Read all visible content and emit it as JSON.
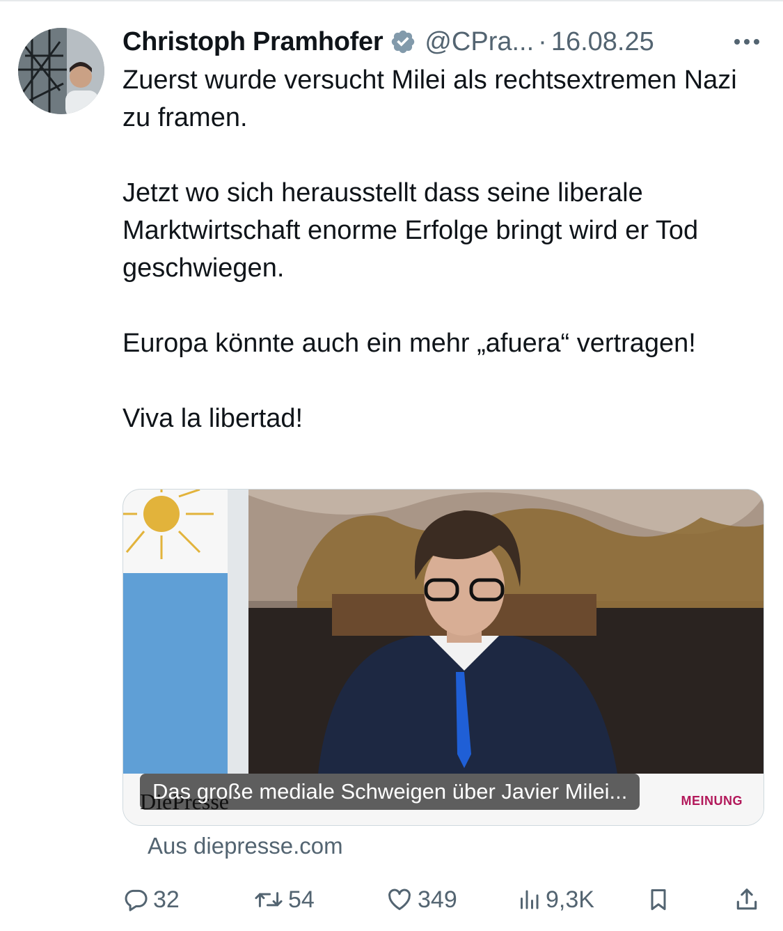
{
  "tweet": {
    "author": {
      "display_name": "Christoph Pramhofer",
      "handle": "@CPra...",
      "verified": true
    },
    "separator": "·",
    "date": "16.08.25",
    "paragraphs": [
      "Zuerst wurde versucht Milei als rechtsextremen Nazi zu framen.",
      "Jetzt wo sich herausstellt dass seine liberale Marktwirtschaft enorme Erfolge bringt wird er Tod geschwiegen.",
      "Europa könnte auch ein mehr „afuera“ vertragen!",
      "Viva la libertad!"
    ]
  },
  "card": {
    "title": "Das große mediale Schweigen über Javier Milei...",
    "brand": "DiePresse",
    "tag": "MEINUNG",
    "source": "Aus diepresse.com"
  },
  "actions": {
    "replies": "32",
    "reposts": "54",
    "likes": "349",
    "views": "9,3K"
  },
  "icons": {
    "verified": "verified-badge-icon",
    "more": "more-dots-icon",
    "reply": "reply-icon",
    "repost": "repost-icon",
    "like": "heart-icon",
    "views": "views-icon",
    "bookmark": "bookmark-icon",
    "share": "share-icon"
  },
  "colors": {
    "text": "#0f1419",
    "muted": "#536471",
    "border": "#cfd9de",
    "verified": "#829aab",
    "tag": "#b2185a"
  }
}
